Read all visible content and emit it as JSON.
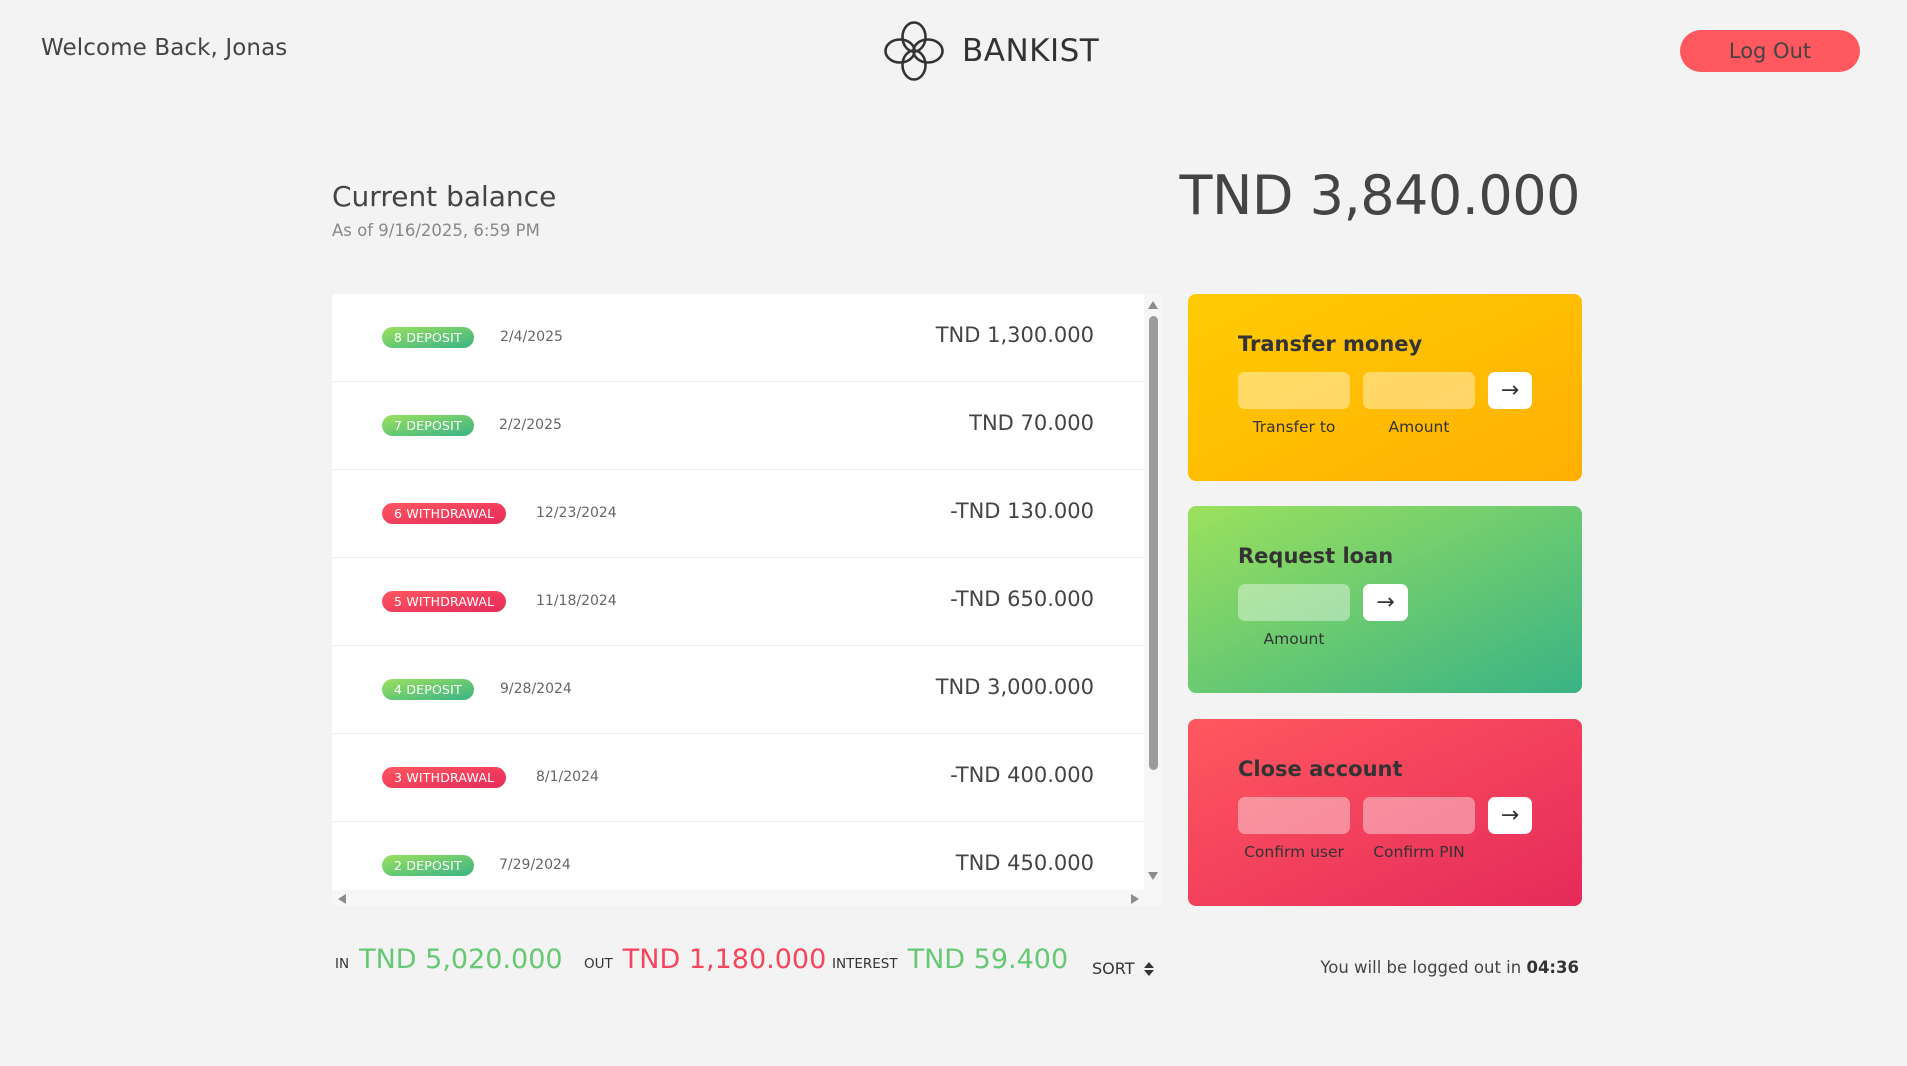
{
  "nav": {
    "welcome": "Welcome Back, Jonas",
    "brand": "BANKIST",
    "logout_label": "Log Out"
  },
  "balance": {
    "label": "Current balance",
    "date": "As of 9/16/2025, 6:59 PM",
    "value": "TND 3,840.000"
  },
  "movements": [
    {
      "type": "deposit",
      "label": "8 DEPOSIT",
      "date": "2/4/2025",
      "value": "TND 1,300.000"
    },
    {
      "type": "deposit",
      "label": "7 DEPOSIT",
      "date": "2/2/2025",
      "value": "TND 70.000"
    },
    {
      "type": "withdrawal",
      "label": "6 WITHDRAWAL",
      "date": "12/23/2024",
      "value": "-TND 130.000"
    },
    {
      "type": "withdrawal",
      "label": "5 WITHDRAWAL",
      "date": "11/18/2024",
      "value": "-TND 650.000"
    },
    {
      "type": "deposit",
      "label": "4 DEPOSIT",
      "date": "9/28/2024",
      "value": "TND 3,000.000"
    },
    {
      "type": "withdrawal",
      "label": "3 WITHDRAWAL",
      "date": "8/1/2024",
      "value": "-TND 400.000"
    },
    {
      "type": "deposit",
      "label": "2 DEPOSIT",
      "date": "7/29/2024",
      "value": "TND 450.000"
    }
  ],
  "operations": {
    "transfer": {
      "title": "Transfer money",
      "to_label": "Transfer to",
      "amount_label": "Amount",
      "to_value": "",
      "amount_value": "",
      "button": "→"
    },
    "loan": {
      "title": "Request loan",
      "amount_label": "Amount",
      "amount_value": "",
      "button": "→"
    },
    "close": {
      "title": "Close account",
      "user_label": "Confirm user",
      "pin_label": "Confirm PIN",
      "user_value": "",
      "pin_value": "",
      "button": "→"
    }
  },
  "summary": {
    "in_label": "In",
    "in_value": "TND 5,020.000",
    "out_label": "Out",
    "out_value": "TND 1,180.000",
    "interest_label": "Interest",
    "interest_value": "TND 59.400",
    "sort_label": "SORT"
  },
  "timer": {
    "prefix": "You will be logged out in ",
    "value": "04:36"
  },
  "colors": {
    "background": "#f3f3f3",
    "logout": "#ff585f",
    "deposit": "#66c873",
    "withdrawal": "#f5465d",
    "transfer_card": "#ffbb03",
    "loan_card": "#6ecb70",
    "close_card": "#f03c5d"
  },
  "icons": {
    "logo": "bankist-logo-icon",
    "submit": "arrow-right-icon",
    "sort": "sort-updown-icon"
  }
}
